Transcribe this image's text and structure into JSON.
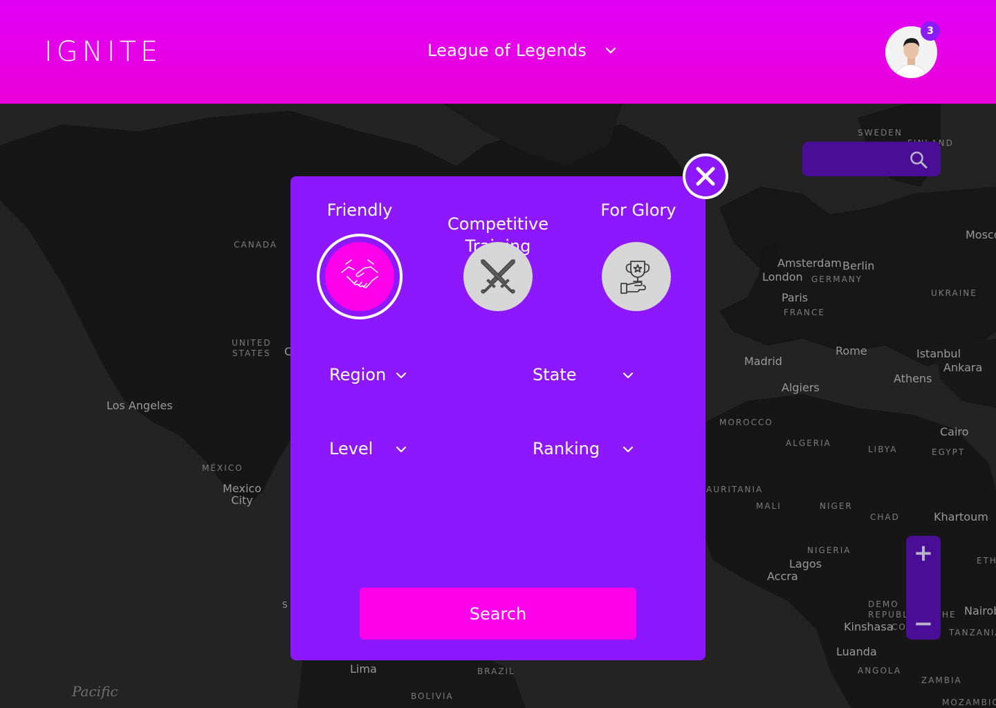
{
  "header": {
    "logo": "IGNITE",
    "game_selector": {
      "label": "League of Legends",
      "icon": "chevron-down-icon"
    },
    "notifications_count": "3",
    "avatar_icon": "user-avatar"
  },
  "map": {
    "search": {
      "value": "",
      "placeholder": ""
    },
    "zoom_in": "+",
    "zoom_out": "−",
    "labels": {
      "sweden": "SWEDEN",
      "finland": "FINLAND",
      "canada": "CANADA",
      "united_states": "UNITED\nSTATES",
      "los_angeles": "Los Angeles",
      "mexico": "MÉXICO",
      "mexico_city": "Mexico\nCity",
      "pacific": "Pacific",
      "lima": "Lima",
      "brazil": "BRAZIL",
      "bolivia": "BOLIVIA",
      "amsterdam": "Amsterdam",
      "berlin": "Berlin",
      "london": "London",
      "germany": "GERMANY",
      "paris": "Paris",
      "france": "FRANCE",
      "ukraine": "UKRAINE",
      "moscow": "Mosco",
      "madrid": "Madrid",
      "rome": "Rome",
      "istanbul": "Istanbul",
      "ankara": "Ankara",
      "athens": "Athens",
      "algiers": "Algiers",
      "morocco": "MOROCCO",
      "algeria": "ALGERIA",
      "libya": "LIBYA",
      "egypt": "EGYPT",
      "cairo": "Cairo",
      "mauritania": "AURITANIA",
      "mali": "MALI",
      "niger": "NIGER",
      "chad": "CHAD",
      "khartoum": "Khartoum",
      "nigeria": "NIGERIA",
      "lagos": "Lagos",
      "accra": "Accra",
      "ethiopia": "ETH",
      "drc": "DEMO\nREPUBLI",
      "kinshasa": "Kinshasa",
      "nairobi": "Nairob",
      "tanzania": "TANZANIA",
      "luanda": "Luanda",
      "angola": "ANGOLA",
      "zambia": "ZAMBIA",
      "mozambique": "MOZAMBIQ",
      "c_partial": "C",
      "co_partial": "CO",
      "he_partial": "HE",
      "s_partial": "S"
    }
  },
  "modal": {
    "close_icon": "close-icon",
    "modes": [
      {
        "label": "Friendly",
        "icon": "handshake-icon",
        "active": true
      },
      {
        "label": "Competitive\nTraining",
        "icon": "crossed-swords-icon",
        "active": false
      },
      {
        "label": "For Glory",
        "icon": "trophy-hand-icon",
        "active": false
      }
    ],
    "filters": {
      "region": "Region",
      "state": "State",
      "level": "Level",
      "ranking": "Ranking"
    },
    "search_button": "Search"
  },
  "colors": {
    "header": "#e000f5",
    "modal": "#8d17fd",
    "accent_pink": "#ff00ea",
    "map_control": "#4a0d96"
  }
}
